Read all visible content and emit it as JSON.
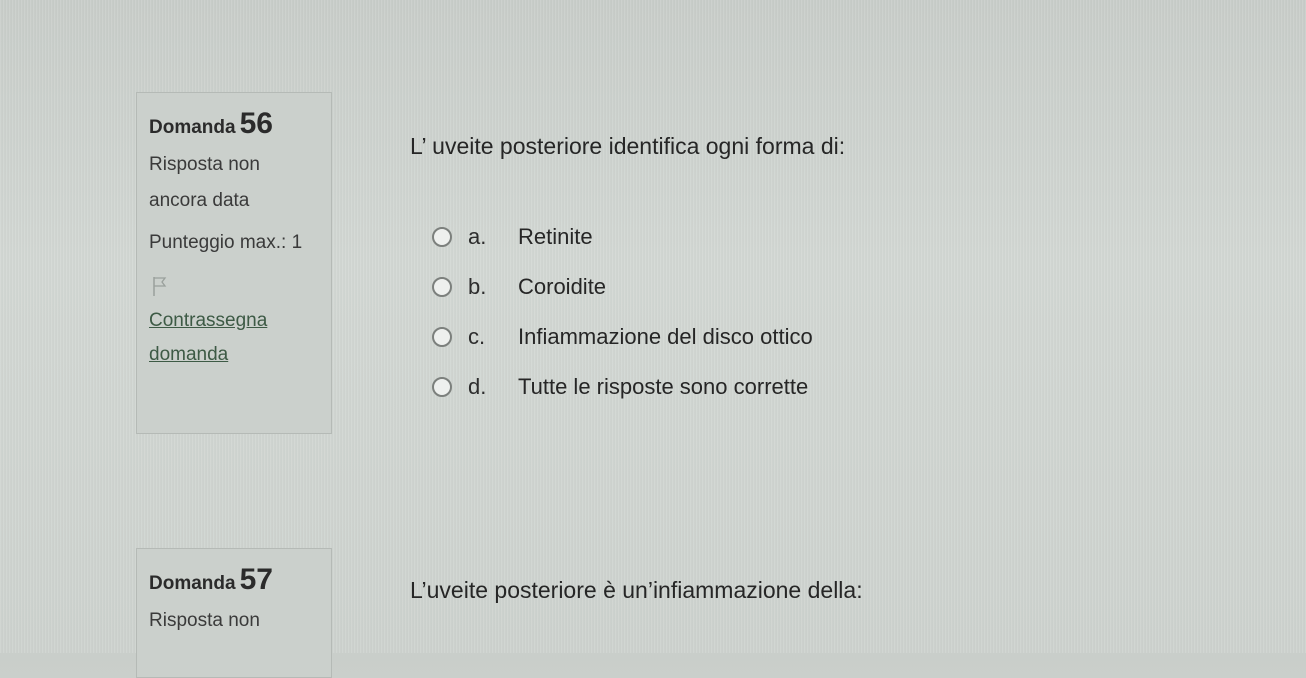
{
  "questions": [
    {
      "label": "Domanda",
      "number": "56",
      "state": "Risposta non ancora data",
      "grade": "Punteggio max.: 1",
      "flag_link": "Contrassegna domanda",
      "text": "L’ uveite posteriore identifica ogni forma di:",
      "options": [
        {
          "letter": "a.",
          "text": "Retinite"
        },
        {
          "letter": "b.",
          "text": "Coroidite"
        },
        {
          "letter": "c.",
          "text": "Infiammazione del disco ottico"
        },
        {
          "letter": "d.",
          "text": "Tutte le risposte sono corrette"
        }
      ]
    },
    {
      "label": "Domanda",
      "number": "57",
      "state": "Risposta non",
      "text": "L’uveite posteriore è un’infiammazione della:"
    }
  ],
  "icons": {
    "flag": "flag-icon",
    "radio": "radio-unchecked-icon"
  },
  "colors": {
    "link": "#3d5a45",
    "panel": "#cbd0cc"
  }
}
